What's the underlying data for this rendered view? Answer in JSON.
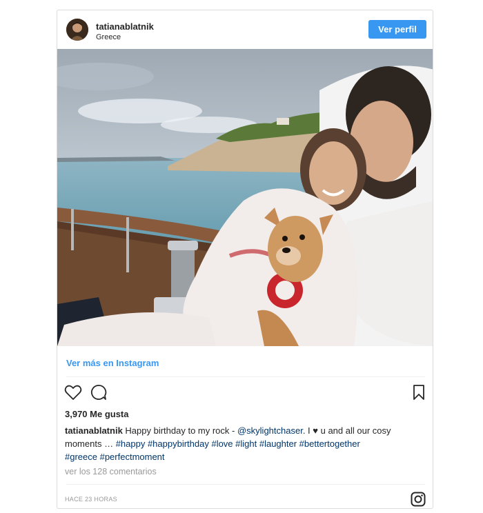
{
  "header": {
    "username": "tatianablatnik",
    "location": "Greece",
    "profile_button": "Ver perfil"
  },
  "post": {
    "image_icon": "photo-couple-with-dog-on-boat",
    "more_link": "Ver más en Instagram",
    "likes": "3,970 Me gusta",
    "caption": {
      "username": "tatianablatnik",
      "text_1": " Happy birthday to my rock - ",
      "mention": "@skylightchaser",
      "text_2": ". I ",
      "heart": "♥",
      "text_3": " u and all our cosy moments … ",
      "hashtags_1": "#happy #happybirthday #love #light #laughter #bettertogether",
      "hashtags_2": "#greece #perfectmoment"
    },
    "comments_link": "ver los 128 comentarios",
    "timestamp": "HACE 23 HORAS"
  },
  "colors": {
    "accent": "#3897f0",
    "link": "#003569",
    "muted": "#999999"
  }
}
